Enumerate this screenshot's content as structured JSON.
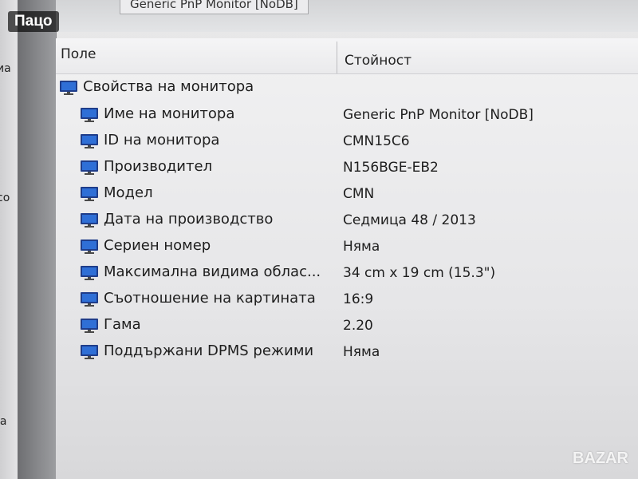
{
  "badge": "Пацо",
  "top_title": "Generic PnP Monitor [NoDB]",
  "left_strip_text": [
    "иа",
    "со",
    "ia"
  ],
  "header": {
    "field": "Поле",
    "value": "Стойност"
  },
  "group": {
    "label": "Свойства на монитора",
    "icon": "monitor-icon"
  },
  "rows": [
    {
      "field": "Име на монитора",
      "value": "Generic PnP Monitor [NoDB]",
      "icon": "monitor-icon"
    },
    {
      "field": "ID на монитора",
      "value": "CMN15C6",
      "icon": "monitor-icon"
    },
    {
      "field": "Производител",
      "value": "N156BGE-EB2",
      "icon": "monitor-icon"
    },
    {
      "field": "Модел",
      "value": "CMN",
      "icon": "monitor-icon"
    },
    {
      "field": "Дата на производство",
      "value": "Седмица 48 / 2013",
      "icon": "monitor-icon"
    },
    {
      "field": "Сериен номер",
      "value": "Няма",
      "icon": "monitor-icon"
    },
    {
      "field": "Максимална видима облас...",
      "value": "34 cm x 19 cm (15.3\")",
      "icon": "monitor-icon"
    },
    {
      "field": "Съотношение на картината",
      "value": "16:9",
      "icon": "monitor-icon"
    },
    {
      "field": "Гама",
      "value": "2.20",
      "icon": "monitor-icon"
    },
    {
      "field": "Поддържани DPMS режими",
      "value": "Няма",
      "icon": "monitor-icon"
    }
  ],
  "watermark": "BAZAR",
  "colors": {
    "monitor_frame": "#1f3d8a",
    "monitor_screen": "#2f6fd6",
    "monitor_base": "#4a4a4a"
  }
}
